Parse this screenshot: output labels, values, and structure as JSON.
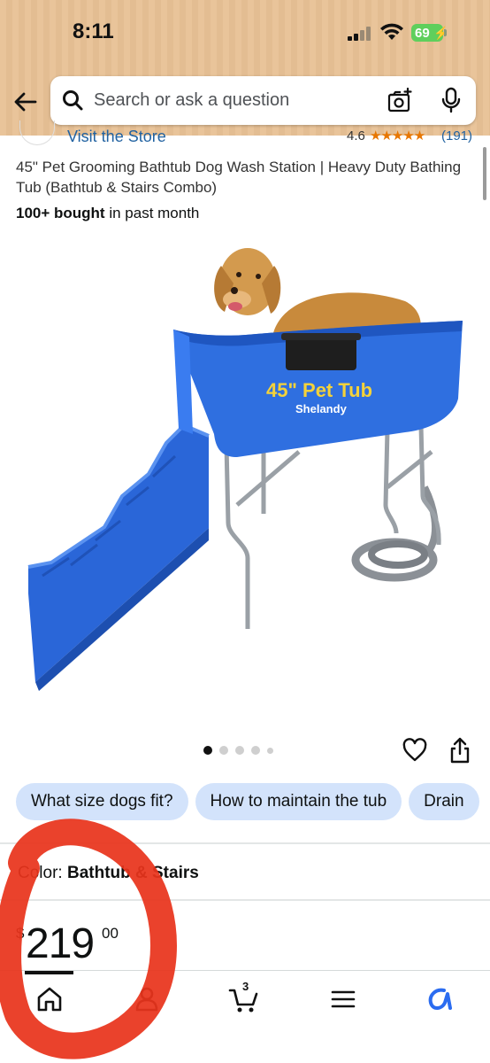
{
  "status_bar": {
    "time": "8:11",
    "battery": "69",
    "icons": [
      "cellular-signal-icon",
      "wifi-icon",
      "battery-charging-icon"
    ]
  },
  "search": {
    "placeholder": "Search or ask a question"
  },
  "store": {
    "link_text": "Visit the Store",
    "rating": "4.6",
    "stars": "★★★★★",
    "rating_count": "(191)"
  },
  "product": {
    "title": "45\" Pet Grooming Bathtub Dog Wash Station | Heavy Duty Bathing Tub (Bathtub & Stairs Combo)",
    "bought_strong": "100+ bought",
    "bought_rest": " in past month",
    "image_text": {
      "tub_label": "45\" Pet Tub",
      "brand": "Shelandy"
    },
    "image_count": 5,
    "active_image_index": 0
  },
  "questions": {
    "chips": [
      "What size dogs fit?",
      "How to maintain the tub",
      "Drain"
    ]
  },
  "color": {
    "label": "Color: ",
    "value": "Bathtub & Stairs"
  },
  "price": {
    "currency": "$",
    "whole": "219",
    "fraction": "00"
  },
  "bottom_nav": {
    "items": [
      "home-icon",
      "account-icon",
      "cart-icon",
      "menu-icon",
      "rufus-icon"
    ],
    "cart_count": "3",
    "active": "home"
  },
  "colors": {
    "header_bg": "#e9c49a",
    "link": "#2162a1",
    "chip_bg": "#d3e3fb",
    "star": "#e77600",
    "tub_blue": "#2f6fe0",
    "annotation_red": "#e8341c"
  }
}
